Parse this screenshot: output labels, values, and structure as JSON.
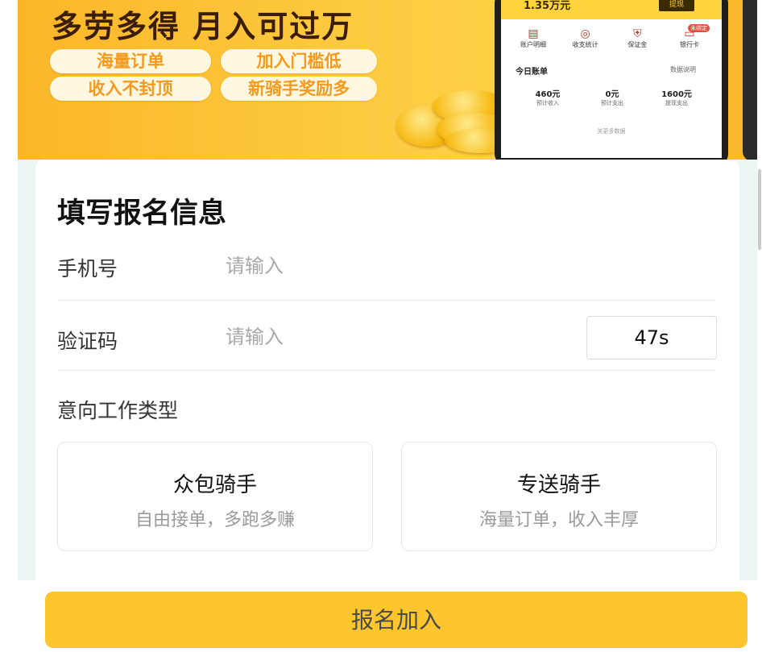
{
  "banner": {
    "title": "多劳多得 月入可过万",
    "pills": [
      "海量订单",
      "加入门槛低",
      "收入不封顶",
      "新骑手奖励多"
    ],
    "phone": {
      "balance": "1.35万元",
      "withdraw": "提现",
      "badge": "未绑定",
      "icons": [
        {
          "icon": "account-detail-icon",
          "label": "账户明细"
        },
        {
          "icon": "income-stats-icon",
          "label": "收支统计"
        },
        {
          "icon": "deposit-shield-icon",
          "label": "保证金"
        },
        {
          "icon": "bank-card-icon",
          "label": "银行卡"
        }
      ],
      "today_label": "今日账单",
      "help_label": "数据说明",
      "stats": [
        {
          "value": "460元",
          "label": "预计收入"
        },
        {
          "value": "0元",
          "label": "预计支出"
        },
        {
          "value": "1600元",
          "label": "提现支出"
        }
      ],
      "more": "关更多数据"
    }
  },
  "form": {
    "title": "填写报名信息",
    "phone_label": "手机号",
    "phone_placeholder": "请输入",
    "phone_value": "",
    "code_label": "验证码",
    "code_placeholder": "请输入",
    "code_value": "",
    "countdown": "47s",
    "type_label": "意向工作类型",
    "options": [
      {
        "title": "众包骑手",
        "subtitle": "自由接单，多跑多赚"
      },
      {
        "title": "专送骑手",
        "subtitle": "海量订单，收入丰厚"
      }
    ]
  },
  "submit_label": "报名加入",
  "colors": {
    "accent": "#fdc62f",
    "banner_orange": "#fbb628",
    "page_bg": "#eaf5f4"
  }
}
